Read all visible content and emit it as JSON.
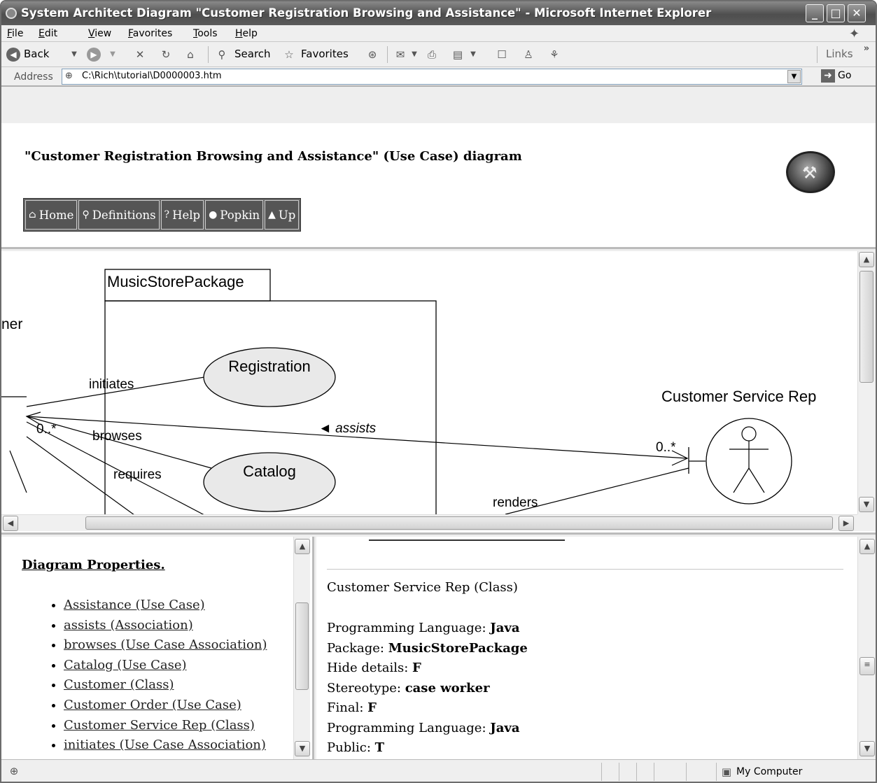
{
  "window": {
    "title": "System Architect Diagram \"Customer Registration Browsing and Assistance\" - Microsoft Internet Explorer",
    "controls": [
      "_",
      "□",
      "✕"
    ]
  },
  "menu": [
    "File",
    "Edit",
    "View",
    "Favorites",
    "Tools",
    "Help"
  ],
  "toolbar": {
    "back": "Back",
    "search": "Search",
    "favorites": "Favorites",
    "links": "Links"
  },
  "address": {
    "label": "Address",
    "value": "C:\\Rich\\tutorial\\D0000003.htm",
    "go": "Go"
  },
  "header": {
    "heading": "\"Customer Registration Browsing and Assistance\" (Use Case) diagram",
    "nav": [
      "Home",
      "Definitions",
      "Help",
      "Popkin",
      "Up"
    ]
  },
  "diagram": {
    "package": "MusicStorePackage",
    "actor_left_partial": "ner",
    "use_cases": [
      "Registration",
      "Catalog"
    ],
    "associations": {
      "initiates": "initiates",
      "browses": "browses",
      "requires": "requires",
      "assists": "◄ assists",
      "renders": "renders",
      "mult_left": "0..*",
      "mult_right": "0..*"
    },
    "actor_right": "Customer Service Rep"
  },
  "properties": {
    "title": "Diagram Properties.",
    "items": [
      "Assistance (Use Case)",
      "assists (Association)",
      "browses (Use Case Association)",
      "Catalog (Use Case)",
      "Customer (Class)",
      "Customer Order (Use Case)",
      "Customer Service Rep (Class)",
      "initiates (Use Case Association)"
    ]
  },
  "details": {
    "heading": "Customer Service Rep (Class)",
    "rows": [
      {
        "label": "Programming Language: ",
        "value": "Java"
      },
      {
        "label": "Package: ",
        "value": "MusicStorePackage"
      },
      {
        "label": "Hide details: ",
        "value": "F"
      },
      {
        "label": "Stereotype: ",
        "value": "case worker"
      },
      {
        "label": "Final: ",
        "value": "F"
      },
      {
        "label": "Programming Language: ",
        "value": "Java"
      },
      {
        "label": "Public: ",
        "value": "T"
      }
    ]
  },
  "status": {
    "zone": "My Computer"
  },
  "colors": {
    "titlebar": "#5a5a5a",
    "navbar": "#555555"
  }
}
